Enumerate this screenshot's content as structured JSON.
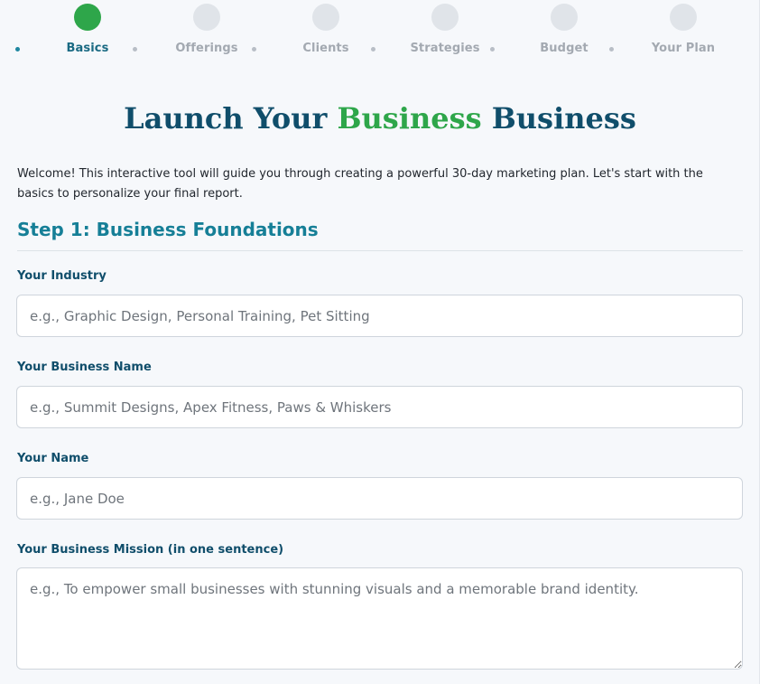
{
  "stepper": {
    "steps": [
      {
        "label": "Basics",
        "active": true
      },
      {
        "label": "Offerings",
        "active": false
      },
      {
        "label": "Clients",
        "active": false
      },
      {
        "label": "Strategies",
        "active": false
      },
      {
        "label": "Budget",
        "active": false
      },
      {
        "label": "Your Plan",
        "active": false
      }
    ]
  },
  "header": {
    "title_prefix": "Launch Your ",
    "title_accent": "Business",
    "title_suffix": " Business"
  },
  "intro": {
    "text": "Welcome! This interactive tool will guide you through creating a powerful 30-day marketing plan. Let's start with the basics to personalize your final report."
  },
  "section": {
    "title": "Step 1: Business Foundations"
  },
  "form": {
    "industry": {
      "label": "Your Industry",
      "value": "",
      "placeholder": "e.g., Graphic Design, Personal Training, Pet Sitting"
    },
    "business_name": {
      "label": "Your Business Name",
      "value": "",
      "placeholder": "e.g., Summit Designs, Apex Fitness, Paws & Whiskers"
    },
    "your_name": {
      "label": "Your Name",
      "value": "",
      "placeholder": "e.g., Jane Doe"
    },
    "mission": {
      "label": "Your Business Mission (in one sentence)",
      "value": "",
      "placeholder": "e.g., To empower small businesses with stunning visuals and a memorable brand identity."
    }
  },
  "colors": {
    "accent_green": "#2ea64a",
    "title_navy": "#104e6b",
    "section_teal": "#167f97",
    "inactive_gray": "#a3a9b1"
  }
}
